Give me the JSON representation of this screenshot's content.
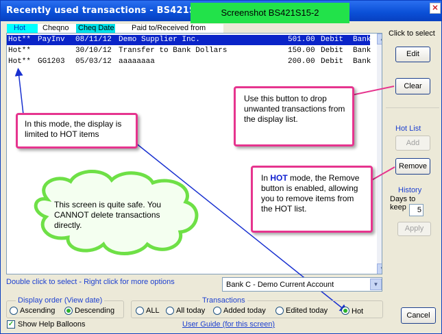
{
  "window": {
    "title": "Recently used transactions - BS421S15",
    "screenshot_label": "Screenshot BS421S15-2",
    "close_glyph": "✕"
  },
  "columns": {
    "hot": "Hot",
    "chequeno": "Cheqno",
    "cheq_date": "Cheq Date",
    "paid_to": "Paid to/Received from"
  },
  "transactions": [
    {
      "hot": "Hot**",
      "ref": "PayInv",
      "date": "08/11/12",
      "name": "Demo Supplier Inc.",
      "amount": "501.00",
      "type": "Debit",
      "account": "Bank",
      "selected": true
    },
    {
      "hot": "Hot**",
      "ref": "",
      "date": "30/10/12",
      "name": "Transfer to Bank Dollars",
      "amount": "150.00",
      "type": "Debit",
      "account": "Bank",
      "selected": false
    },
    {
      "hot": "Hot**",
      "ref": "GG1203",
      "date": "05/03/12",
      "name": "aaaaaaaa",
      "amount": "200.00",
      "type": "Debit",
      "account": "Bank",
      "selected": false
    }
  ],
  "callouts": {
    "hot_mode_display": "In this mode, the display is limited to HOT items",
    "clear_button": "Use this button to drop unwanted transactions from the display list.",
    "remove_pre": "In ",
    "remove_hot": "HOT",
    "remove_post": " mode, the Remove button is enabled, allowing you to remove items from the HOT list.",
    "safe_screen": "This screen is quite safe. You CANNOT delete transactions directly."
  },
  "right_panel": {
    "click_to_select": "Click to select",
    "edit": "Edit",
    "clear": "Clear",
    "hot_list": "Hot List",
    "add": "Add",
    "remove": "Remove",
    "history": "History",
    "days_to_keep": "Days to keep",
    "days_value": "5",
    "apply": "Apply",
    "cancel": "Cancel"
  },
  "bottom": {
    "hint": "Double click to select - Right click for more options",
    "account_selected": "Bank C - Demo Current Account",
    "display_order_legend": "Display order (View date)",
    "ascending": "Ascending",
    "descending": "Descending",
    "transactions_legend": "Transactions",
    "all": "ALL",
    "all_today": "All today",
    "added_today": "Added today",
    "edited_today": "Edited today",
    "hot": "Hot",
    "show_help": "Show Help Balloons",
    "user_guide": "User Guide (for this screen)"
  },
  "colors": {
    "title_blue": "#0a4fd6",
    "screenshot_green": "#22e24a",
    "callout_border": "#e6348e",
    "selection_blue": "#0a24c8",
    "cloud_fill": "#f4fff0",
    "cloud_edge": "#6ee046",
    "arrow_blue": "#1830d0"
  }
}
